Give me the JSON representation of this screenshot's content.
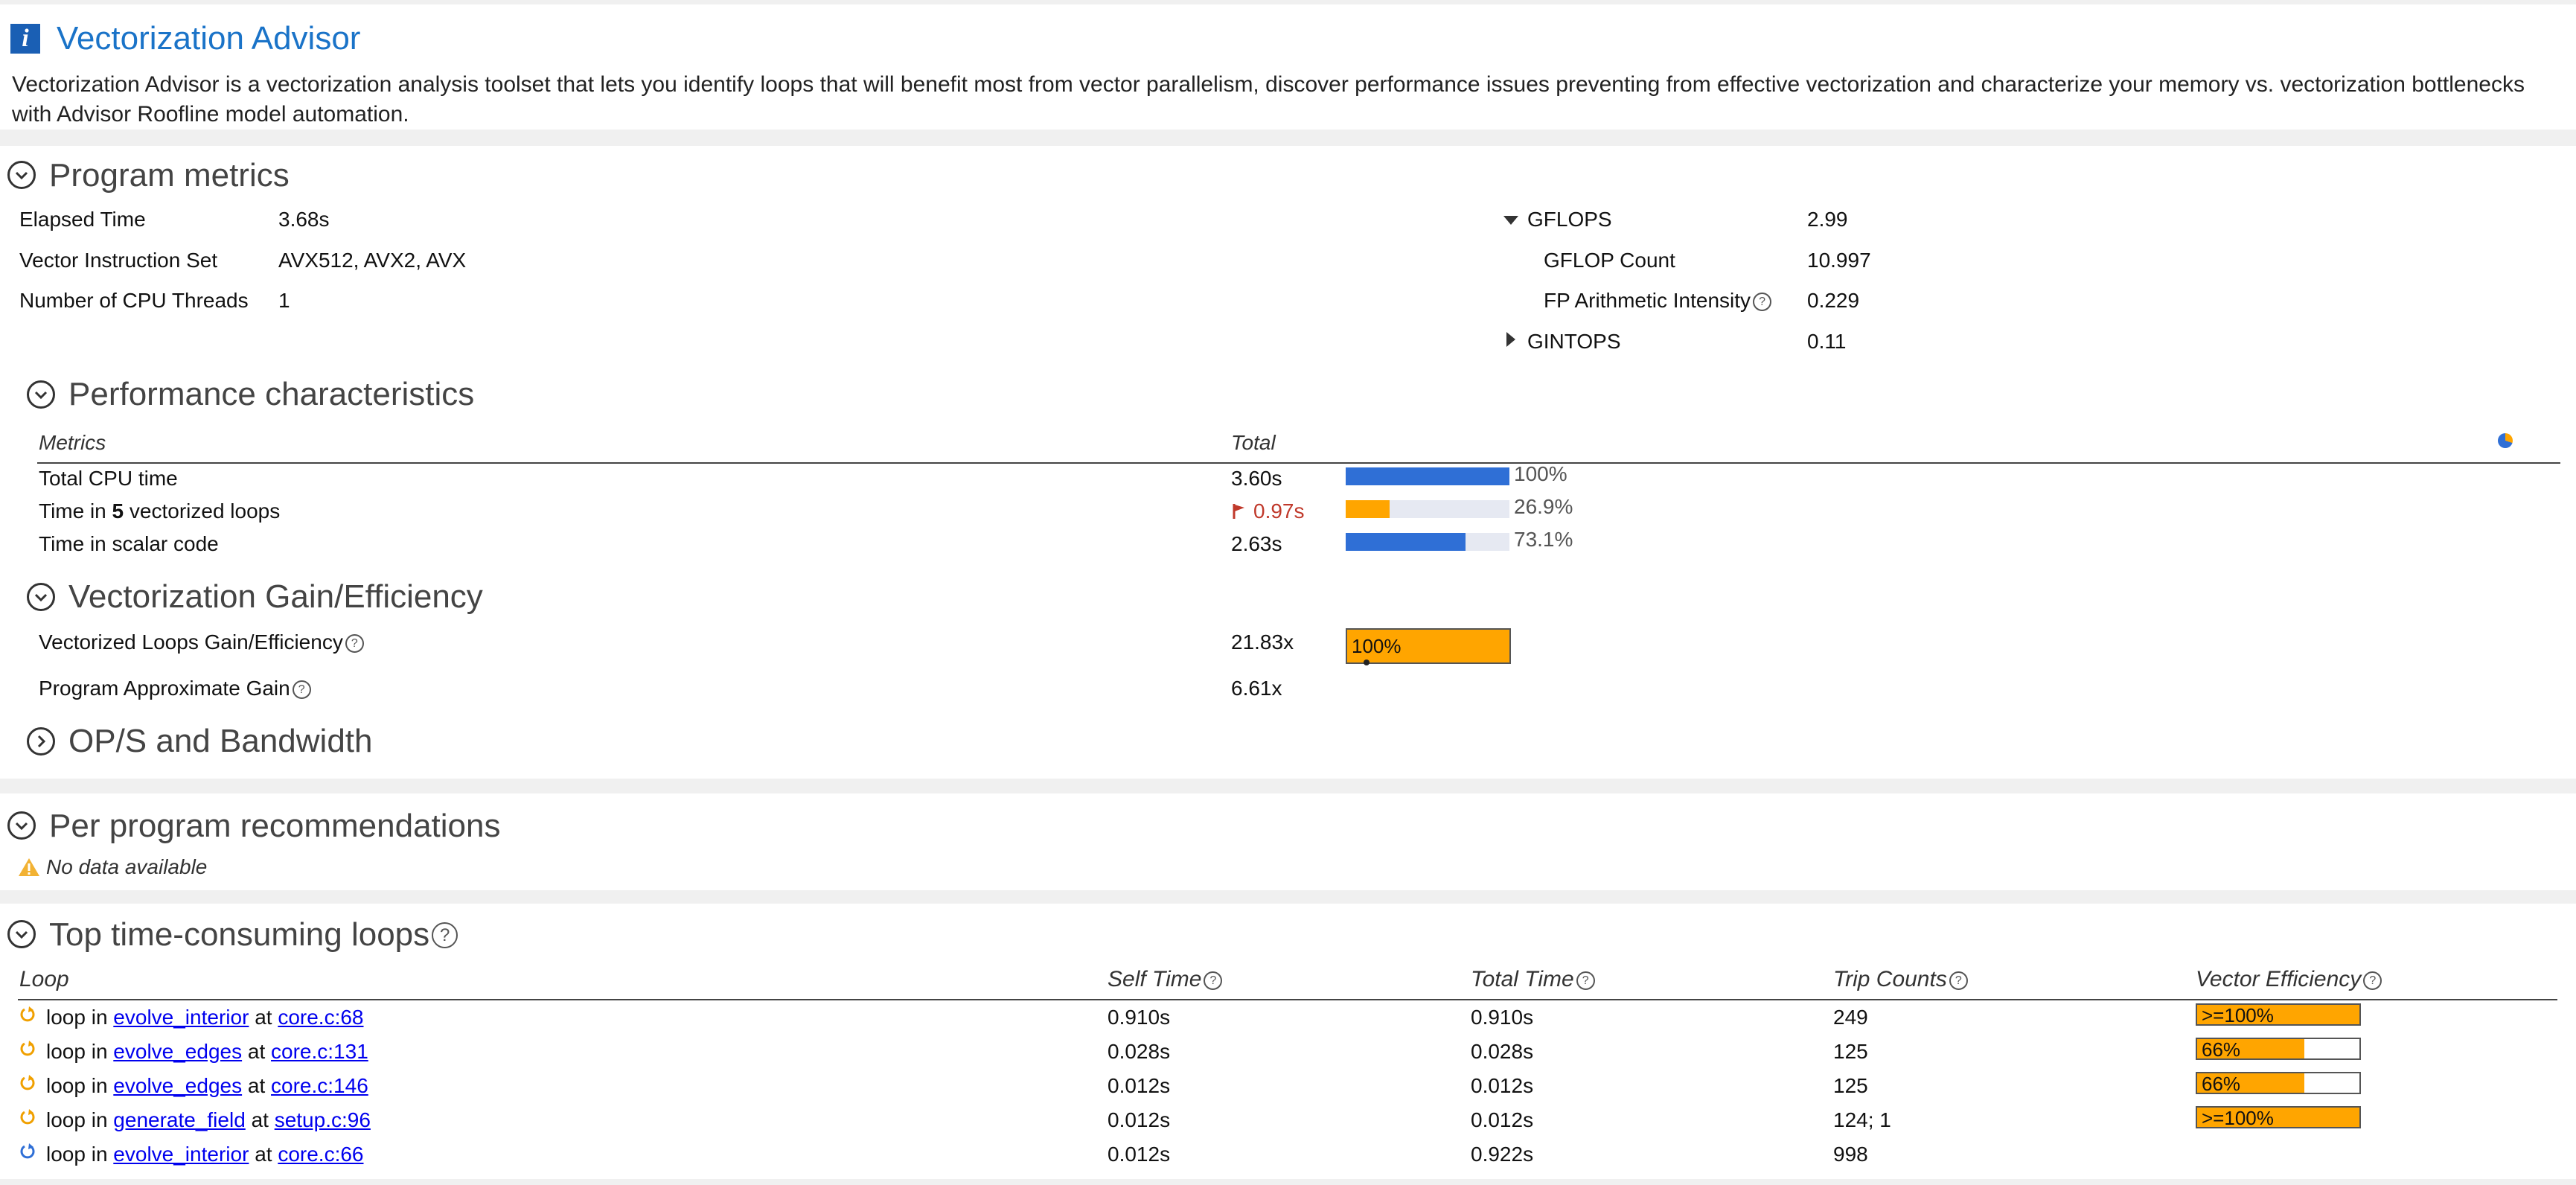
{
  "header": {
    "title": "Vectorization Advisor",
    "description": "Vectorization Advisor is a vectorization analysis toolset that lets you identify loops that will benefit most from vector parallelism, discover performance issues preventing from effective vectorization and characterize your memory vs. vectorization bottlenecks with Advisor Roofline model automation."
  },
  "program_metrics": {
    "title": "Program metrics",
    "left": [
      {
        "label": "Elapsed Time",
        "value": "3.68s"
      },
      {
        "label": "Vector Instruction Set",
        "value": "AVX512, AVX2, AVX"
      },
      {
        "label": "Number of CPU Threads",
        "value": "1"
      }
    ],
    "gflops": {
      "label": "GFLOPS",
      "value": "2.99"
    },
    "gflop_count": {
      "label": "GFLOP Count",
      "value": "10.997"
    },
    "fp_intensity": {
      "label": "FP Arithmetic Intensity",
      "value": "0.229"
    },
    "gintops": {
      "label": "GINTOPS",
      "value": "0.11"
    }
  },
  "performance": {
    "title": "Performance characteristics",
    "col_metrics": "Metrics",
    "col_total": "Total",
    "rows": [
      {
        "label": "Total CPU time",
        "value": "3.60s",
        "percent_text": "100%",
        "fraction": 1.0,
        "color": "#2f6fd6"
      },
      {
        "label_pre": "Time in ",
        "label_bold": "5",
        "label_post": " vectorized loops",
        "value": "0.97s",
        "percent_text": "26.9%",
        "fraction": 0.269,
        "color": "#ffa500"
      },
      {
        "label": "Time in scalar code",
        "value": "2.63s",
        "percent_text": "73.1%",
        "fraction": 0.731,
        "color": "#2f6fd6"
      }
    ]
  },
  "vectorization_gain": {
    "title": "Vectorization Gain/Efficiency",
    "rows": [
      {
        "label": "Vectorized Loops Gain/Efficiency",
        "value": "21.83x",
        "bar_label": "100%",
        "fraction": 1.0
      },
      {
        "label": "Program Approximate Gain",
        "value": "6.61x"
      }
    ]
  },
  "ops_bandwidth": {
    "title": "OP/S and Bandwidth"
  },
  "recommendations": {
    "title": "Per program recommendations",
    "empty_text": "No data available"
  },
  "top_loops": {
    "title": "Top time-consuming loops",
    "columns": {
      "loop": "Loop",
      "self_time": "Self Time",
      "total_time": "Total Time",
      "trip_counts": "Trip Counts",
      "vector_efficiency": "Vector Efficiency"
    },
    "rows": [
      {
        "prefix": "loop in",
        "func": "evolve_interior",
        "at": "at",
        "loc": "core.c:68",
        "self": "0.910s",
        "total": "0.910s",
        "trips": "249",
        "eff_label": ">=100%",
        "eff_fraction": 1.0,
        "icon_color": "#f0a000"
      },
      {
        "prefix": "loop in",
        "func": "evolve_edges",
        "at": "at",
        "loc": "core.c:131",
        "self": "0.028s",
        "total": "0.028s",
        "trips": "125",
        "eff_label": "66%",
        "eff_fraction": 0.66,
        "icon_color": "#f0a000"
      },
      {
        "prefix": "loop in",
        "func": "evolve_edges",
        "at": "at",
        "loc": "core.c:146",
        "self": "0.012s",
        "total": "0.012s",
        "trips": "125",
        "eff_label": "66%",
        "eff_fraction": 0.66,
        "icon_color": "#f0a000"
      },
      {
        "prefix": "loop in",
        "func": "generate_field",
        "at": "at",
        "loc": "setup.c:96",
        "self": "0.012s",
        "total": "0.012s",
        "trips": "124; 1",
        "eff_label": ">=100%",
        "eff_fraction": 1.0,
        "icon_color": "#f0a000"
      },
      {
        "prefix": "loop in",
        "func": "evolve_interior",
        "at": "at",
        "loc": "core.c:66",
        "self": "0.012s",
        "total": "0.922s",
        "trips": "998",
        "eff_label": "",
        "eff_fraction": 0,
        "icon_color": "#2f6fd6"
      }
    ]
  },
  "colors": {
    "accent": "#1a73c8",
    "orange": "#ffa500",
    "blue_bar": "#2f6fd6",
    "flag_red": "#c0392b"
  }
}
